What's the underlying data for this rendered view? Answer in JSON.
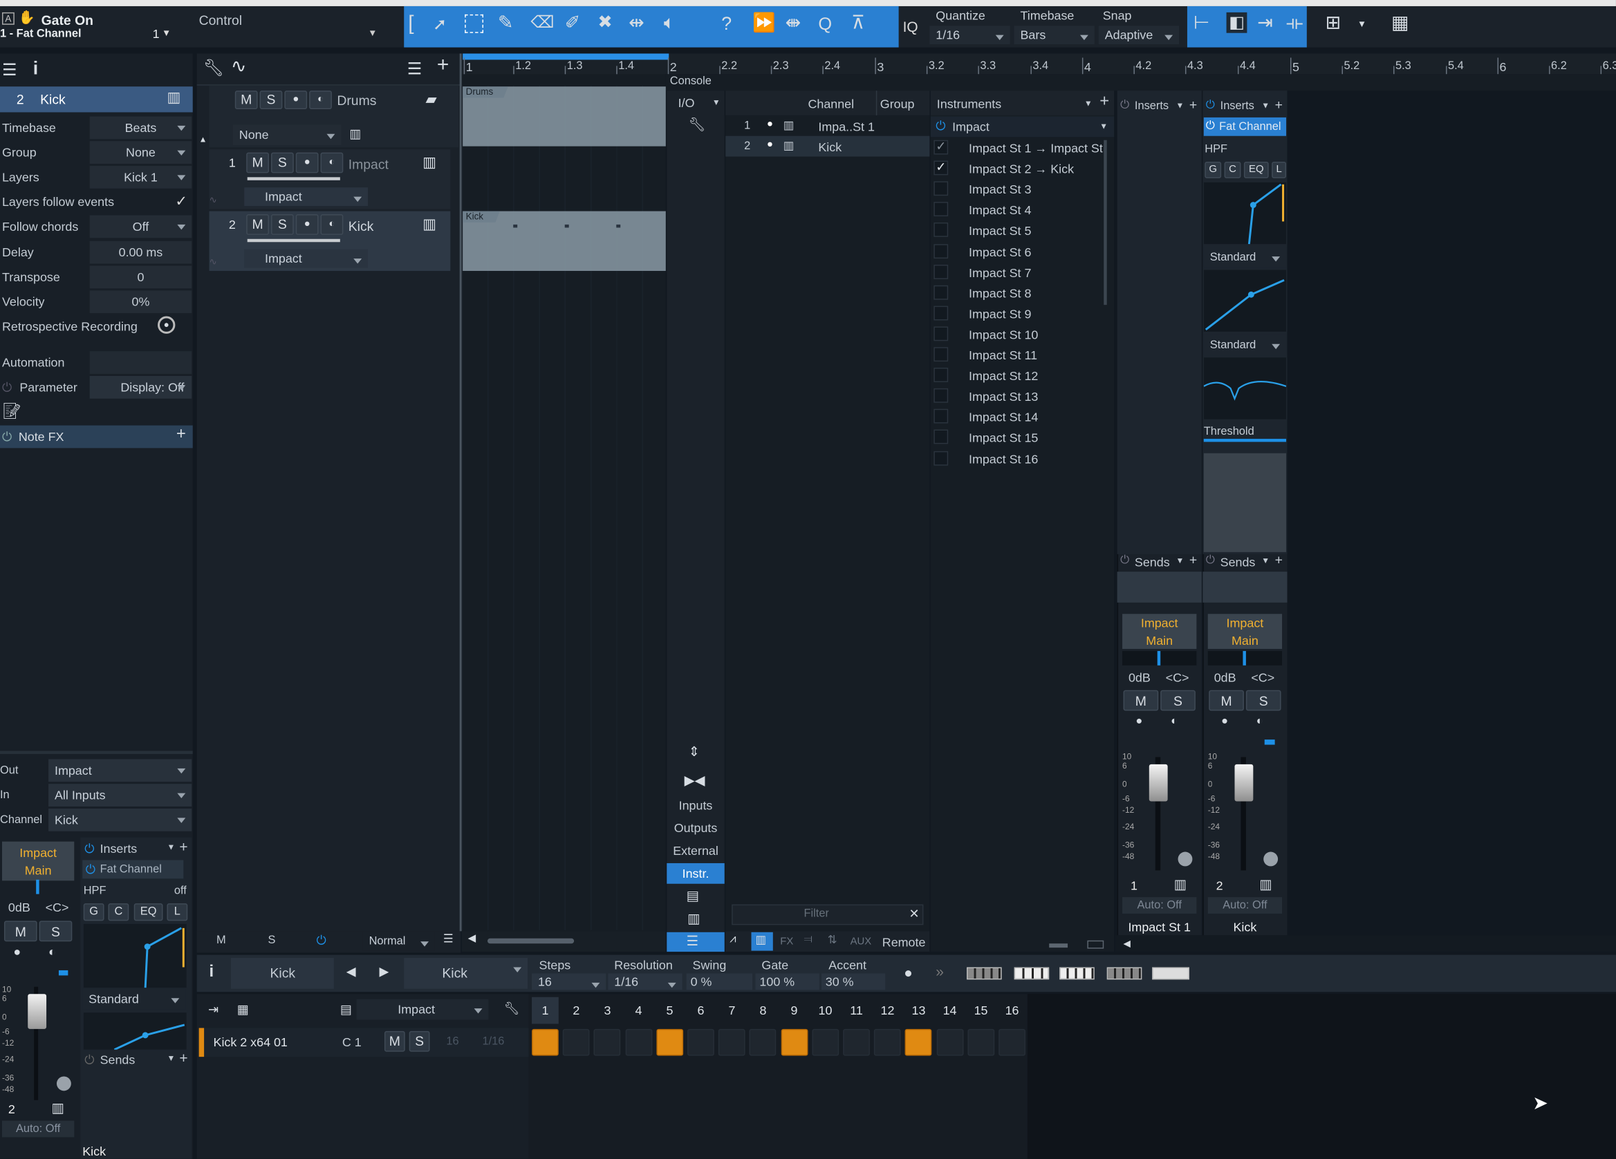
{
  "topbar": {
    "track_label": "Gate On",
    "channel_label": "1 - Fat Channel",
    "channel_num": "1",
    "control_label": "Control",
    "iq": "IQ",
    "quantize_label": "Quantize",
    "quantize_value": "1/16",
    "timebase_label": "Timebase",
    "timebase_value": "Bars",
    "snap_label": "Snap",
    "snap_value": "Adaptive",
    "help": "?"
  },
  "inspector": {
    "track_num": "2",
    "track_name": "Kick",
    "rows": [
      {
        "label": "Timebase",
        "value": "Beats"
      },
      {
        "label": "Group",
        "value": "None"
      },
      {
        "label": "Layers",
        "value": "Kick 1"
      },
      {
        "label": "Layers follow events",
        "value": "✓"
      },
      {
        "label": "Follow chords",
        "value": "Off"
      },
      {
        "label": "Delay",
        "value": "0.00 ms"
      },
      {
        "label": "Transpose",
        "value": "0"
      },
      {
        "label": "Velocity",
        "value": "0%"
      },
      {
        "label": "Retrospective Recording",
        "value": ""
      }
    ],
    "automation_label": "Automation",
    "parameter_label": "Parameter",
    "display_value": "Display: Off",
    "notefx_label": "Note FX",
    "out_label": "Out",
    "out_value": "Impact",
    "in_label": "In",
    "in_value": "All Inputs",
    "channel_label": "Channel",
    "channel_value": "Kick",
    "mini_out_line1": "Impact",
    "mini_out_line2": "Main",
    "db": "0dB",
    "pan": "<C>",
    "m": "M",
    "s": "S",
    "inserts_label": "Inserts",
    "fat_channel": "Fat Channel",
    "hpf": "HPF",
    "hpf_state": "off",
    "g": "G",
    "c": "C",
    "eq": "EQ",
    "l": "L",
    "standard": "Standard",
    "sends_label": "Sends",
    "ch_num": "2",
    "auto": "Auto: Off",
    "bottom_name": "Kick",
    "scale": [
      "10",
      "6",
      "0",
      "-6",
      "-12",
      "-24",
      "-36",
      "-48"
    ]
  },
  "tracks": {
    "folder_name": "Drums",
    "m": "M",
    "s": "S",
    "none_value": "None",
    "list": [
      {
        "num": "1",
        "name": "Impact",
        "instr": "Impact"
      },
      {
        "num": "2",
        "name": "Kick",
        "instr": "Impact"
      }
    ],
    "footer_m": "M",
    "footer_s": "S",
    "footer_normal": "Normal"
  },
  "timeline": {
    "ruler": [
      "1",
      "1.2",
      "1.3",
      "1.4",
      "2",
      "2.2",
      "2.3",
      "2.4",
      "3",
      "3.2",
      "3.3",
      "3.4",
      "4",
      "4.2",
      "4.3",
      "4.4",
      "5",
      "5.2",
      "5.3",
      "5.4",
      "6",
      "6.2",
      "6.3"
    ],
    "drums_clip": "Drums",
    "kick_clip": "Kick"
  },
  "console": {
    "title": "Console",
    "io_label": "I/O",
    "nav": [
      "Inputs",
      "Outputs",
      "External",
      "Instr."
    ],
    "channel_header": "Channel",
    "group_header": "Group",
    "channels": [
      {
        "num": "1",
        "name": "Impa..St 1"
      },
      {
        "num": "2",
        "name": "Kick"
      }
    ],
    "instruments_header": "Instruments",
    "instrument_name": "Impact",
    "outputs": [
      {
        "name": "Impact St 1 → Impact St 1",
        "checked": "✓"
      },
      {
        "name": "Impact St 2 → Kick",
        "checked": "✓"
      },
      {
        "name": "Impact St 3",
        "checked": ""
      },
      {
        "name": "Impact St 4",
        "checked": ""
      },
      {
        "name": "Impact St 5",
        "checked": ""
      },
      {
        "name": "Impact St 6",
        "checked": ""
      },
      {
        "name": "Impact St 7",
        "checked": ""
      },
      {
        "name": "Impact St 8",
        "checked": ""
      },
      {
        "name": "Impact St 9",
        "checked": ""
      },
      {
        "name": "Impact St 10",
        "checked": ""
      },
      {
        "name": "Impact St 11",
        "checked": ""
      },
      {
        "name": "Impact St 12",
        "checked": ""
      },
      {
        "name": "Impact St 13",
        "checked": ""
      },
      {
        "name": "Impact St 14",
        "checked": ""
      },
      {
        "name": "Impact St 15",
        "checked": ""
      },
      {
        "name": "Impact St 16",
        "checked": ""
      }
    ],
    "filter_placeholder": "Filter",
    "fx": "FX",
    "aux": "AUX",
    "remote": "Remote",
    "strips": [
      {
        "inserts": "Inserts",
        "insert_item": "",
        "sends": "Sends",
        "out1": "Impact",
        "out2": "Main",
        "db": "0dB",
        "pan": "<C>",
        "m": "M",
        "s": "S",
        "num": "1",
        "auto": "Auto: Off",
        "name": "Impact St 1"
      },
      {
        "inserts": "Inserts",
        "insert_item": "Fat Channel",
        "sends": "Sends",
        "out1": "Impact",
        "out2": "Main",
        "db": "0dB",
        "pan": "<C>",
        "m": "M",
        "s": "S",
        "num": "2",
        "auto": "Auto: Off",
        "name": "Kick"
      }
    ],
    "fat": {
      "hpf": "HPF",
      "g": "G",
      "c": "C",
      "eq": "EQ",
      "l": "L",
      "standard1": "Standard",
      "standard2": "Standard",
      "threshold": "Threshold"
    },
    "scale": [
      "10",
      "6",
      "0",
      "-6",
      "-12",
      "-24",
      "-36",
      "-48"
    ]
  },
  "pattern": {
    "instrument": "Kick",
    "pattern_name": "Kick",
    "steps_label": "Steps",
    "steps_value": "16",
    "resolution_label": "Resolution",
    "resolution_value": "1/16",
    "swing_label": "Swing",
    "swing_value": "0 %",
    "gate_label": "Gate",
    "gate_value": "100 %",
    "accent_label": "Accent",
    "accent_value": "30 %",
    "target": "Impact",
    "step_numbers": [
      "1",
      "2",
      "3",
      "4",
      "5",
      "6",
      "7",
      "8",
      "9",
      "10",
      "11",
      "12",
      "13",
      "14",
      "15",
      "16"
    ],
    "row": {
      "name": "Kick 2 x64 01",
      "note": "C 1",
      "m": "M",
      "s": "S",
      "steps": "16",
      "res": "1/16"
    },
    "active_steps": [
      1,
      5,
      9,
      13
    ],
    "accent_color": "#e08a12"
  }
}
